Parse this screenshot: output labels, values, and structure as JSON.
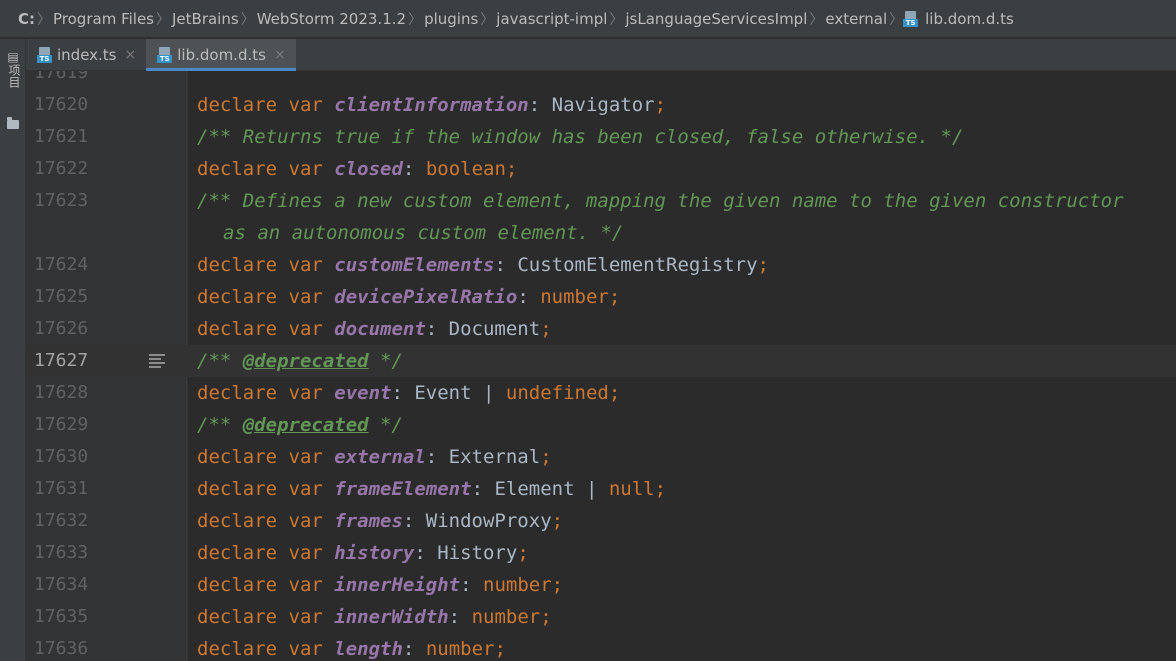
{
  "breadcrumb": {
    "drive": "C:",
    "items": [
      "Program Files",
      "JetBrains",
      "WebStorm 2023.1.2",
      "plugins",
      "javascript-impl",
      "jsLanguageServicesImpl",
      "external"
    ],
    "file": "lib.dom.d.ts",
    "file_icon_label": "TS"
  },
  "toolstrip": {
    "project_label": "项目",
    "project_glyph": "▤"
  },
  "tabs": [
    {
      "label": "index.ts",
      "icon_label": "TS",
      "close": "×",
      "active": false
    },
    {
      "label": "lib.dom.d.ts",
      "icon_label": "TS",
      "close": "×",
      "active": true
    }
  ],
  "editor": {
    "lines": [
      {
        "n": "17619",
        "partial": true
      },
      {
        "n": "17620",
        "tokens": [
          [
            "kw",
            "declare var "
          ],
          [
            "fld",
            "clientInformation"
          ],
          [
            "typ",
            ": Navigator"
          ],
          [
            "punc",
            ";"
          ]
        ]
      },
      {
        "n": "17621",
        "tokens": [
          [
            "cmt",
            "/** Returns true if the window has been closed, false otherwise. */"
          ]
        ]
      },
      {
        "n": "17622",
        "tokens": [
          [
            "kw",
            "declare var "
          ],
          [
            "fld",
            "closed"
          ],
          [
            "typ",
            ": "
          ],
          [
            "kw",
            "boolean"
          ],
          [
            "punc",
            ";"
          ]
        ]
      },
      {
        "n": "17623",
        "tokens": [
          [
            "cmt",
            "/** Defines a new custom element, mapping the given name to the given constructor"
          ]
        ]
      },
      {
        "n": "",
        "cont": true,
        "tokens": [
          [
            "cmt",
            "as an autonomous custom element. */"
          ]
        ]
      },
      {
        "n": "17624",
        "tokens": [
          [
            "kw",
            "declare var "
          ],
          [
            "fld",
            "customElements"
          ],
          [
            "typ",
            ": CustomElementRegistry"
          ],
          [
            "punc",
            ";"
          ]
        ]
      },
      {
        "n": "17625",
        "tokens": [
          [
            "kw",
            "declare var "
          ],
          [
            "fld",
            "devicePixelRatio"
          ],
          [
            "typ",
            ": "
          ],
          [
            "kw",
            "number"
          ],
          [
            "punc",
            ";"
          ]
        ]
      },
      {
        "n": "17626",
        "tokens": [
          [
            "kw",
            "declare var "
          ],
          [
            "fld",
            "document"
          ],
          [
            "typ",
            ": Document"
          ],
          [
            "punc",
            ";"
          ]
        ]
      },
      {
        "n": "17627",
        "current": true,
        "tokens": [
          [
            "cmt",
            "/** "
          ],
          [
            "tag",
            "@deprecated"
          ],
          [
            "cmt",
            " */"
          ]
        ]
      },
      {
        "n": "17628",
        "tokens": [
          [
            "kw",
            "declare var "
          ],
          [
            "fld",
            "event"
          ],
          [
            "typ",
            ": Event "
          ],
          [
            "bar",
            "|"
          ],
          [
            "typ",
            " "
          ],
          [
            "kw",
            "undefined"
          ],
          [
            "punc",
            ";"
          ]
        ]
      },
      {
        "n": "17629",
        "tokens": [
          [
            "cmt",
            "/** "
          ],
          [
            "tag",
            "@deprecated"
          ],
          [
            "cmt",
            " */"
          ]
        ]
      },
      {
        "n": "17630",
        "tokens": [
          [
            "kw",
            "declare var "
          ],
          [
            "fld",
            "external"
          ],
          [
            "typ",
            ": External"
          ],
          [
            "punc",
            ";"
          ]
        ]
      },
      {
        "n": "17631",
        "tokens": [
          [
            "kw",
            "declare var "
          ],
          [
            "fld",
            "frameElement"
          ],
          [
            "typ",
            ": Element "
          ],
          [
            "bar",
            "|"
          ],
          [
            "typ",
            " "
          ],
          [
            "kw",
            "null"
          ],
          [
            "punc",
            ";"
          ]
        ]
      },
      {
        "n": "17632",
        "tokens": [
          [
            "kw",
            "declare var "
          ],
          [
            "fld",
            "frames"
          ],
          [
            "typ",
            ": WindowProxy"
          ],
          [
            "punc",
            ";"
          ]
        ]
      },
      {
        "n": "17633",
        "tokens": [
          [
            "kw",
            "declare var "
          ],
          [
            "fld",
            "history"
          ],
          [
            "typ",
            ": History"
          ],
          [
            "punc",
            ";"
          ]
        ]
      },
      {
        "n": "17634",
        "tokens": [
          [
            "kw",
            "declare var "
          ],
          [
            "fld",
            "innerHeight"
          ],
          [
            "typ",
            ": "
          ],
          [
            "kw",
            "number"
          ],
          [
            "punc",
            ";"
          ]
        ]
      },
      {
        "n": "17635",
        "tokens": [
          [
            "kw",
            "declare var "
          ],
          [
            "fld",
            "innerWidth"
          ],
          [
            "typ",
            ": "
          ],
          [
            "kw",
            "number"
          ],
          [
            "punc",
            ";"
          ]
        ]
      },
      {
        "n": "17636",
        "tokens": [
          [
            "kw",
            "declare var "
          ],
          [
            "fld",
            "length"
          ],
          [
            "typ",
            ": "
          ],
          [
            "kw",
            "number"
          ],
          [
            "punc",
            ";"
          ]
        ]
      }
    ]
  },
  "colors": {
    "keyword": "#cc7832",
    "field": "#9876aa",
    "comment": "#629755",
    "text": "#a9b7c6",
    "background": "#2b2b2b"
  }
}
